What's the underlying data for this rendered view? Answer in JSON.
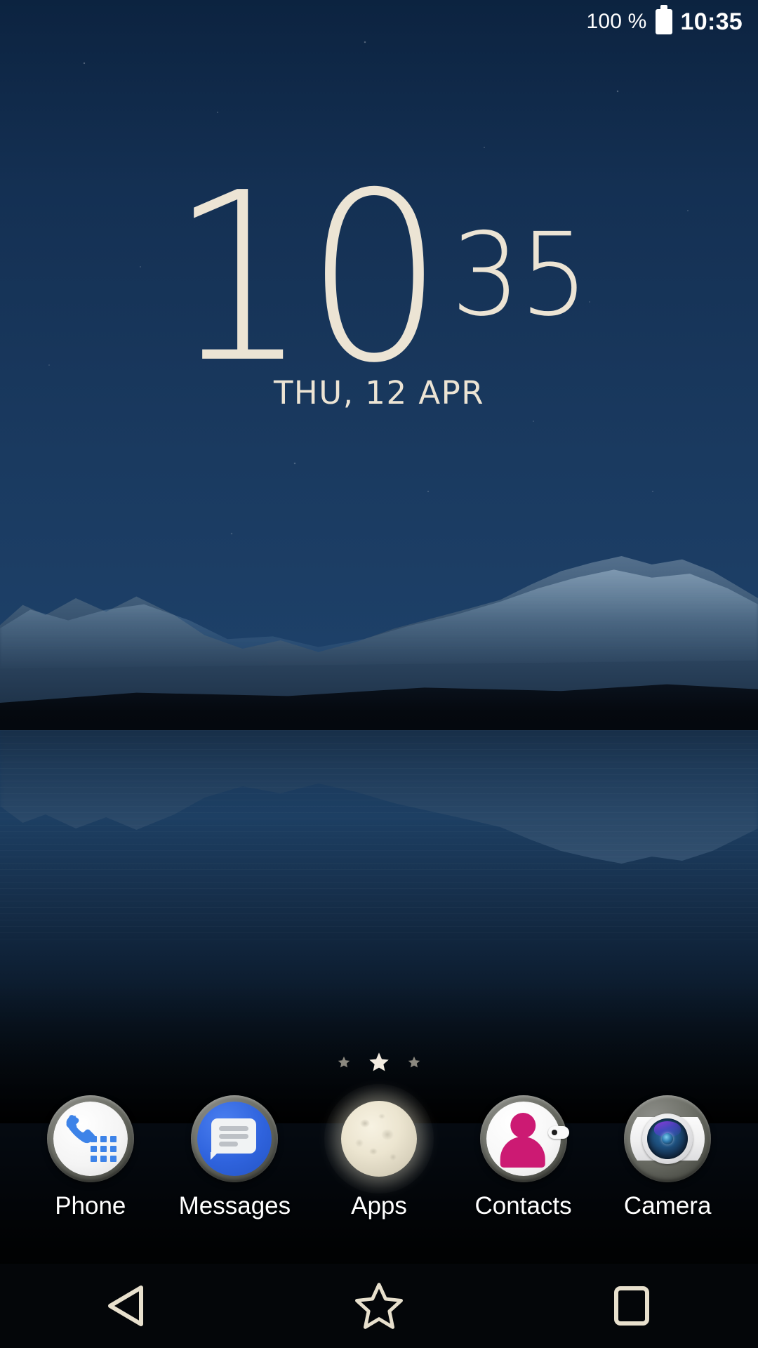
{
  "status_bar": {
    "battery_percent": "100 %",
    "battery_icon": "battery-full-icon",
    "clock": "10:35"
  },
  "clock_widget": {
    "hour": "10",
    "minute": "35",
    "date": "THU, 12 APR",
    "color": "#ece4d4"
  },
  "page_indicator": {
    "icon": "star-icon",
    "total_pages": 3,
    "active_page": 2
  },
  "dock": {
    "items": [
      {
        "label": "Phone",
        "icon": "phone-icon"
      },
      {
        "label": "Messages",
        "icon": "message-bubble-icon"
      },
      {
        "label": "Apps",
        "icon": "moon-icon"
      },
      {
        "label": "Contacts",
        "icon": "person-icon"
      },
      {
        "label": "Camera",
        "icon": "camera-lens-icon"
      }
    ]
  },
  "nav_bar": {
    "back": {
      "name": "back-button",
      "icon": "triangle-left-icon"
    },
    "home": {
      "name": "home-button",
      "icon": "star-outline-icon"
    },
    "recents": {
      "name": "recents-button",
      "icon": "square-outline-icon"
    },
    "icon_color": "#e8e0cd"
  },
  "wallpaper": {
    "description": "Night mountain lake with reflection",
    "sky_color": "#1a3a60",
    "water_color": "#1d3f63"
  }
}
